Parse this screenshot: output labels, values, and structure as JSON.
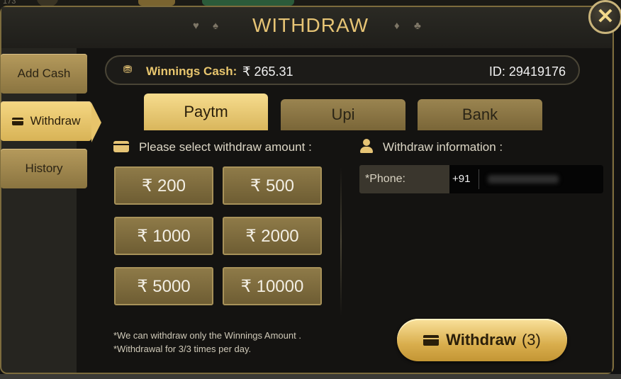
{
  "background": {
    "top_left_number": "173"
  },
  "dialog": {
    "title": "WITHDRAW",
    "title_color": "#e6c475",
    "accent_color": "#d9b65c",
    "close_icon": "close-icon"
  },
  "sidebar": {
    "items": [
      {
        "label": "Add Cash",
        "active": false
      },
      {
        "label": "Withdraw",
        "active": true,
        "icon": "card-icon"
      },
      {
        "label": "History",
        "active": false
      }
    ]
  },
  "winnings": {
    "icon": "coin-icon",
    "label": "Winnings Cash:",
    "value": "₹ 265.31",
    "id_text": "ID: 29419176"
  },
  "tabs": [
    {
      "label": "Paytm",
      "active": true
    },
    {
      "label": "Upi",
      "active": false
    },
    {
      "label": "Bank",
      "active": false
    }
  ],
  "amount_section": {
    "icon": "wallet-icon",
    "label": "Please select withdraw amount :",
    "amounts": [
      "₹ 200",
      "₹ 500",
      "₹ 1000",
      "₹ 2000",
      "₹ 5000",
      "₹ 10000"
    ]
  },
  "info_section": {
    "icon": "person-icon",
    "label": "Withdraw information :",
    "phone_label": "*Phone:",
    "phone_prefix": "+91"
  },
  "notes": [
    "*We can withdraw only the Winnings Amount .",
    "*Withdrawal for 3/3 times per day."
  ],
  "withdraw_button": {
    "icon": "card-icon",
    "label": "Withdraw",
    "count": "(3)"
  }
}
